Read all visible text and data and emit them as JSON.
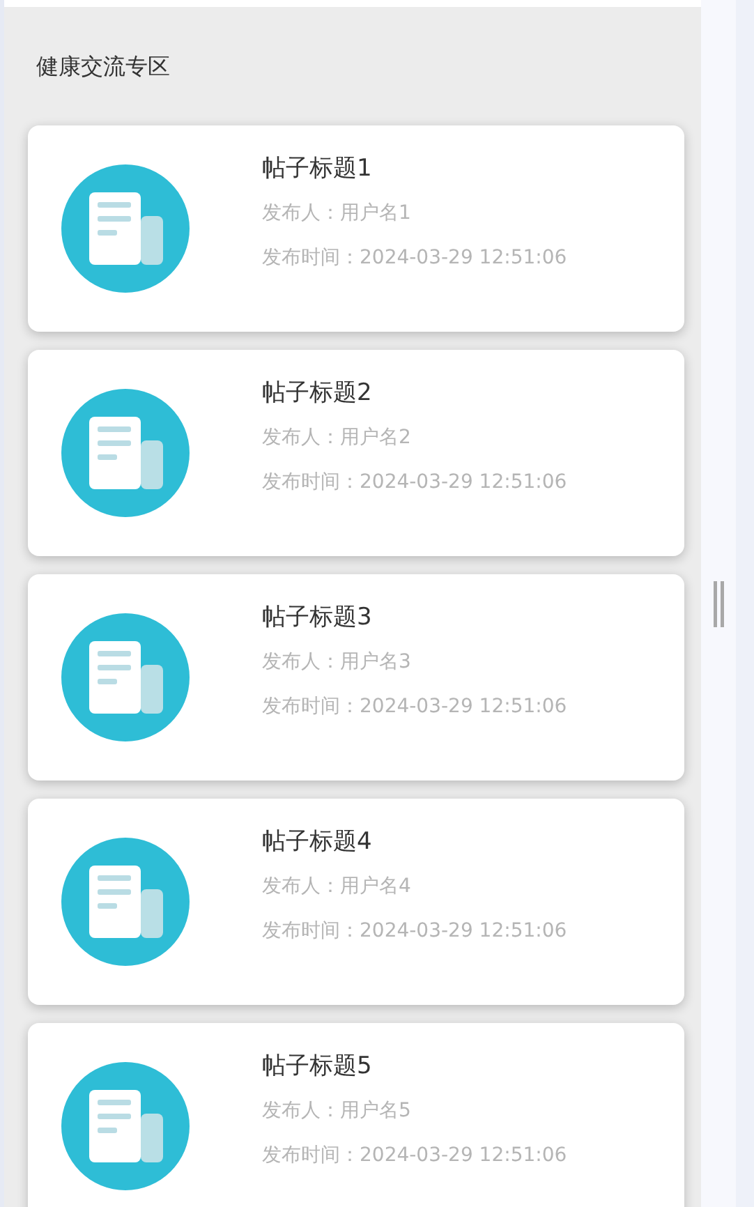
{
  "section_title": "健康交流专区",
  "posts": [
    {
      "title": "帖子标题1",
      "author": "发布人：用户名1",
      "time": "发布时间：2024-03-29 12:51:06"
    },
    {
      "title": "帖子标题2",
      "author": "发布人：用户名2",
      "time": "发布时间：2024-03-29 12:51:06"
    },
    {
      "title": "帖子标题3",
      "author": "发布人：用户名3",
      "time": "发布时间：2024-03-29 12:51:06"
    },
    {
      "title": "帖子标题4",
      "author": "发布人：用户名4",
      "time": "发布时间：2024-03-29 12:51:06"
    },
    {
      "title": "帖子标题5",
      "author": "发布人：用户名5",
      "time": "发布时间：2024-03-29 12:51:06"
    }
  ]
}
